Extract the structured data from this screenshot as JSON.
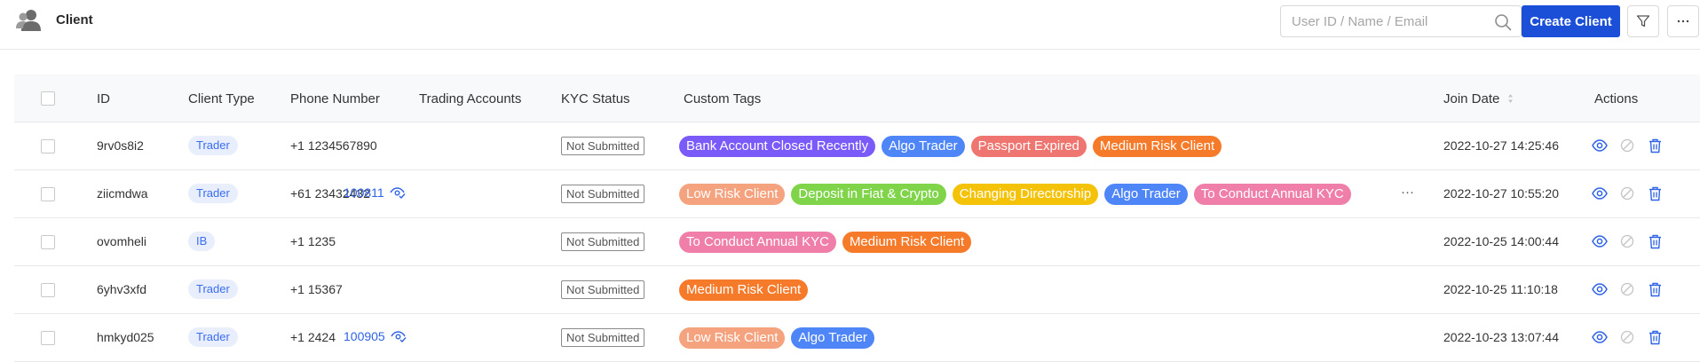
{
  "header": {
    "title": "Client",
    "search_placeholder": "User ID / Name / Email",
    "create_label": "Create Client"
  },
  "columns": {
    "id": "ID",
    "client_type": "Client Type",
    "phone": "Phone Number",
    "trading": "Trading Accounts",
    "kyc": "KYC Status",
    "tags": "Custom Tags",
    "join_date": "Join Date",
    "actions": "Actions"
  },
  "tag_colors": {
    "Bank Account Closed Recently": "#7a5af8",
    "Algo Trader": "#4f86f7",
    "Passport Expired": "#ef7570",
    "Medium Risk Client": "#f57a2a",
    "Low Risk Client": "#f5a27e",
    "Deposit in Fiat & Crypto": "#7fd44a",
    "Changing Directorship": "#f5c20a",
    "To Conduct Annual KYC": "#ef7ea8"
  },
  "rows": [
    {
      "id": "9rv0s8i2",
      "type": "Trader",
      "phone": "+1 1234567890",
      "account": "",
      "kyc": "Not Submitted",
      "tags": [
        "Bank Account Closed Recently",
        "Algo Trader",
        "Passport Expired",
        "Medium Risk Client"
      ],
      "more": "",
      "date": "2022-10-27 14:25:46"
    },
    {
      "id": "ziicmdwa",
      "type": "Trader",
      "phone": "+61 23432432",
      "account": "100811",
      "kyc": "Not Submitted",
      "tags": [
        "Low Risk Client",
        "Deposit in Fiat & Crypto",
        "Changing Directorship",
        "Algo Trader",
        "To Conduct Annual KYC"
      ],
      "more": "···",
      "date": "2022-10-27 10:55:20"
    },
    {
      "id": "ovomheli",
      "type": "IB",
      "phone": "+1 1235",
      "account": "",
      "kyc": "Not Submitted",
      "tags": [
        "To Conduct Annual KYC",
        "Medium Risk Client"
      ],
      "more": "",
      "date": "2022-10-25 14:00:44"
    },
    {
      "id": "6yhv3xfd",
      "type": "Trader",
      "phone": "+1 15367",
      "account": "",
      "kyc": "Not Submitted",
      "tags": [
        "Medium Risk Client"
      ],
      "more": "",
      "date": "2022-10-25 11:10:18"
    },
    {
      "id": "hmkyd025",
      "type": "Trader",
      "phone": "+1 2424",
      "account": "100905",
      "kyc": "Not Submitted",
      "tags": [
        "Low Risk Client",
        "Algo Trader"
      ],
      "more": "",
      "date": "2022-10-23 13:07:44"
    }
  ]
}
